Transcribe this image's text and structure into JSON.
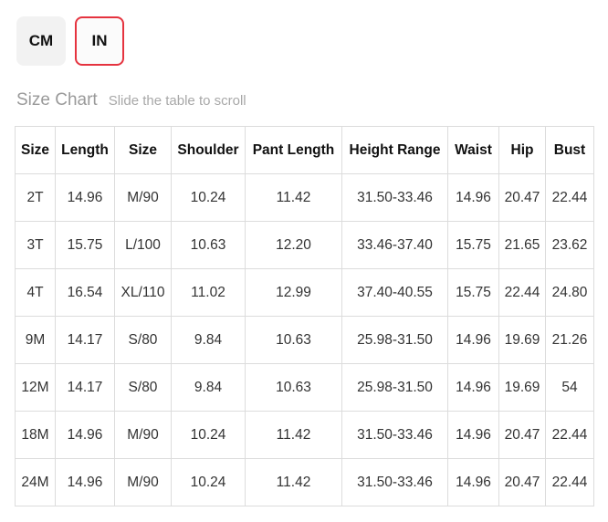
{
  "units": {
    "cm_label": "CM",
    "in_label": "IN",
    "active": "IN",
    "active_border_color": "#e5333f"
  },
  "size_chart": {
    "title": "Size Chart",
    "hint": "Slide the table to scroll",
    "headers": [
      "Size",
      "Length",
      "Size",
      "Shoulder",
      "Pant Length",
      "Height Range",
      "Waist",
      "Hip",
      "Bust"
    ],
    "rows": [
      [
        "2T",
        "14.96",
        "M/90",
        "10.24",
        "11.42",
        "31.50-33.46",
        "14.96",
        "20.47",
        "22.44"
      ],
      [
        "3T",
        "15.75",
        "L/100",
        "10.63",
        "12.20",
        "33.46-37.40",
        "15.75",
        "21.65",
        "23.62"
      ],
      [
        "4T",
        "16.54",
        "XL/110",
        "11.02",
        "12.99",
        "37.40-40.55",
        "15.75",
        "22.44",
        "24.80"
      ],
      [
        "9M",
        "14.17",
        "S/80",
        "9.84",
        "10.63",
        "25.98-31.50",
        "14.96",
        "19.69",
        "21.26"
      ],
      [
        "12M",
        "14.17",
        "S/80",
        "9.84",
        "10.63",
        "25.98-31.50",
        "14.96",
        "19.69",
        "54"
      ],
      [
        "18M",
        "14.96",
        "M/90",
        "10.24",
        "11.42",
        "31.50-33.46",
        "14.96",
        "20.47",
        "22.44"
      ],
      [
        "24M",
        "14.96",
        "M/90",
        "10.24",
        "11.42",
        "31.50-33.46",
        "14.96",
        "20.47",
        "22.44"
      ]
    ]
  }
}
